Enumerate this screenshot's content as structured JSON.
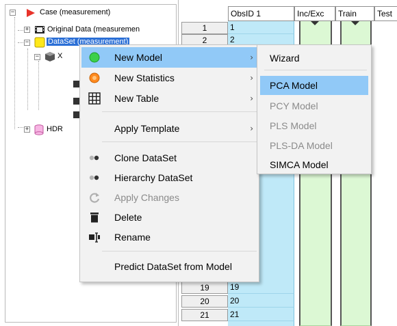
{
  "tree": {
    "items": [
      {
        "label": "Case (measurement)",
        "expander": "−"
      },
      {
        "label": "Original Data (measuremen",
        "expander": "+"
      },
      {
        "label": "DataSet (measurement)",
        "expander": "−",
        "selected": true
      },
      {
        "label": "X",
        "expander": "−"
      },
      {
        "label": "HDR",
        "expander": "+"
      }
    ]
  },
  "grid": {
    "columns": [
      "ObsID 1",
      "Inc/Exc",
      "Train",
      "Test"
    ],
    "rows": [
      {
        "num": "1",
        "obs": "1"
      },
      {
        "num": "2",
        "obs": "2"
      },
      {
        "num": "19",
        "obs": "19"
      },
      {
        "num": "20",
        "obs": "20"
      },
      {
        "num": "21",
        "obs": "21"
      }
    ]
  },
  "context_menu": {
    "items": [
      {
        "label": "New Model",
        "icon": "green-circle-icon",
        "submenu": true,
        "highlighted": true
      },
      {
        "label": "New Statistics",
        "icon": "orange-circle-icon",
        "submenu": true
      },
      {
        "label": "New Table",
        "icon": "table-grid-icon",
        "submenu": true
      },
      {
        "label": "Apply Template",
        "submenu": true
      },
      {
        "label": "Clone DataSet",
        "icon": "clone-dots-icon"
      },
      {
        "label": "Hierarchy DataSet",
        "icon": "hierarchy-dots-icon"
      },
      {
        "label": "Apply Changes",
        "icon": "refresh-icon",
        "disabled": true
      },
      {
        "label": "Delete",
        "icon": "trash-icon"
      },
      {
        "label": "Rename",
        "icon": "rename-cursor-icon"
      },
      {
        "label": "Predict DataSet from Model"
      }
    ],
    "arrow": "›"
  },
  "submenu": {
    "items": [
      {
        "label": "Wizard"
      },
      {
        "label": "PCA Model",
        "highlighted": true
      },
      {
        "label": "PCY Model",
        "disabled": true
      },
      {
        "label": "PLS Model",
        "disabled": true
      },
      {
        "label": "PLS-DA Model",
        "disabled": true
      },
      {
        "label": "SIMCA Model"
      }
    ]
  },
  "colors": {
    "highlight": "#91c9f7",
    "selection": "#2b6fd6",
    "obs_cell": "#bfe9f8",
    "green_cell": "#dcf8d4"
  }
}
